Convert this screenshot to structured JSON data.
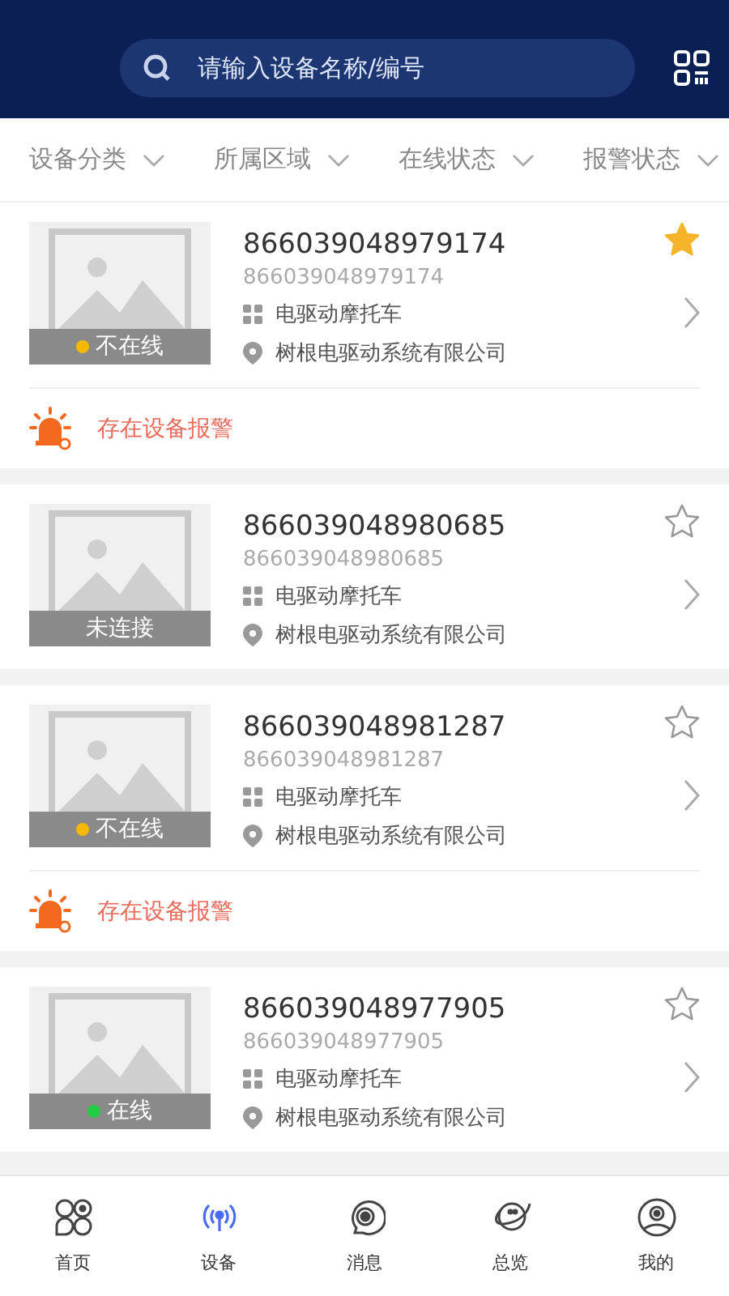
{
  "search": {
    "placeholder": "请输入设备名称/编号"
  },
  "filters": [
    {
      "label": "设备分类"
    },
    {
      "label": "所属区域"
    },
    {
      "label": "在线状态"
    },
    {
      "label": "报警状态"
    }
  ],
  "devices": [
    {
      "name": "866039048979174",
      "code": "866039048979174",
      "type": "电驱动摩托车",
      "company": "树根电驱动系统有限公司",
      "status": "不在线",
      "color": "#f5b800",
      "favorite": true,
      "alarm": "存在设备报警"
    },
    {
      "name": "866039048980685",
      "code": "866039048980685",
      "type": "电驱动摩托车",
      "company": "树根电驱动系统有限公司",
      "status": "未连接",
      "favorite": false
    },
    {
      "name": "866039048981287",
      "code": "866039048981287",
      "type": "电驱动摩托车",
      "company": "树根电驱动系统有限公司",
      "status": "不在线",
      "color": "#f5b800",
      "favorite": false,
      "alarm": "存在设备报警"
    },
    {
      "name": "866039048977905",
      "code": "866039048977905",
      "type": "电驱动摩托车",
      "company": "树根电驱动系统有限公司",
      "status": "在线",
      "color": "#22cc44",
      "favorite": false
    }
  ],
  "nav": [
    {
      "label": "首页",
      "kind": "home",
      "selected": false
    },
    {
      "label": "设备",
      "kind": "device",
      "selected": true
    },
    {
      "label": "消息",
      "kind": "message",
      "selected": false
    },
    {
      "label": "总览",
      "kind": "overview",
      "selected": false
    },
    {
      "label": "我的",
      "kind": "profile",
      "selected": false
    }
  ]
}
